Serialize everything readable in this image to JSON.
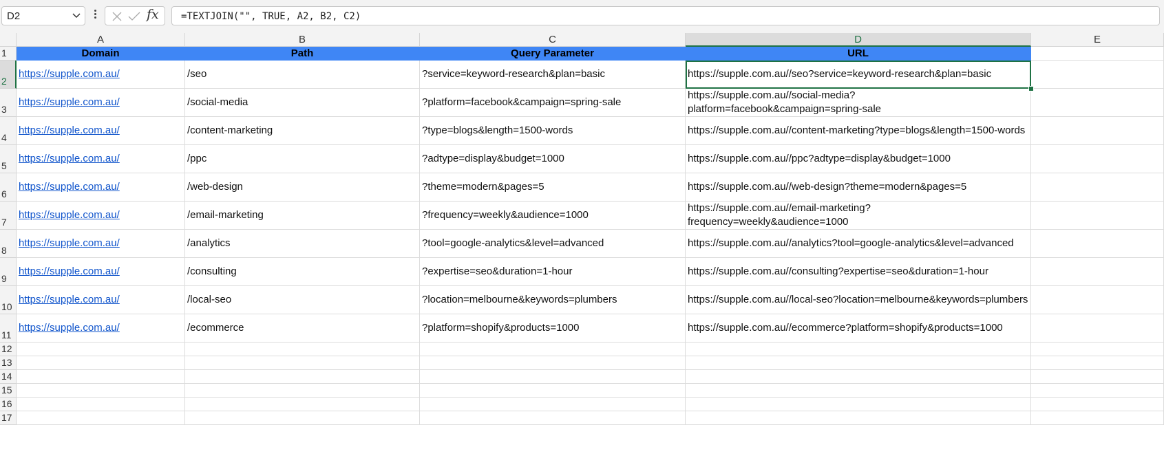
{
  "name_box": "D2",
  "formula": "=TEXTJOIN(\"\", TRUE, A2, B2, C2)",
  "fx_label": "fx",
  "columns": [
    "A",
    "B",
    "C",
    "D",
    "E"
  ],
  "row_numbers": [
    "1",
    "2",
    "3",
    "4",
    "5",
    "6",
    "7",
    "8",
    "9",
    "10",
    "11",
    "12",
    "13",
    "14",
    "15",
    "16",
    "17"
  ],
  "headers": [
    "Domain",
    "Path",
    "Query Parameter",
    "URL"
  ],
  "rows": [
    [
      "https://supple.com.au/",
      "/seo",
      "?service=keyword-research&plan=basic",
      "https://supple.com.au//seo?service=keyword-research&plan=basic"
    ],
    [
      "https://supple.com.au/",
      "/social-media",
      "?platform=facebook&campaign=spring-sale",
      "https://supple.com.au//social-media?platform=facebook&campaign=spring-sale"
    ],
    [
      "https://supple.com.au/",
      "/content-marketing",
      "?type=blogs&length=1500-words",
      "https://supple.com.au//content-marketing?type=blogs&length=1500-words"
    ],
    [
      "https://supple.com.au/",
      "/ppc",
      "?adtype=display&budget=1000",
      "https://supple.com.au//ppc?adtype=display&budget=1000"
    ],
    [
      "https://supple.com.au/",
      "/web-design",
      "?theme=modern&pages=5",
      "https://supple.com.au//web-design?theme=modern&pages=5"
    ],
    [
      "https://supple.com.au/",
      "/email-marketing",
      "?frequency=weekly&audience=1000",
      "https://supple.com.au//email-marketing?frequency=weekly&audience=1000"
    ],
    [
      "https://supple.com.au/",
      "/analytics",
      "?tool=google-analytics&level=advanced",
      "https://supple.com.au//analytics?tool=google-analytics&level=advanced"
    ],
    [
      "https://supple.com.au/",
      "/consulting",
      "?expertise=seo&duration=1-hour",
      "https://supple.com.au//consulting?expertise=seo&duration=1-hour"
    ],
    [
      "https://supple.com.au/",
      "/local-seo",
      "?location=melbourne&keywords=plumbers",
      "https://supple.com.au//local-seo?location=melbourne&keywords=plumbers"
    ],
    [
      "https://supple.com.au/",
      "/ecommerce",
      "?platform=shopify&products=1000",
      "https://supple.com.au//ecommerce?platform=shopify&products=1000"
    ]
  ],
  "selected_cell": "D2",
  "colors": {
    "header_fill": "#3f86f5",
    "link": "#1155cc",
    "selection": "#1f7244"
  }
}
